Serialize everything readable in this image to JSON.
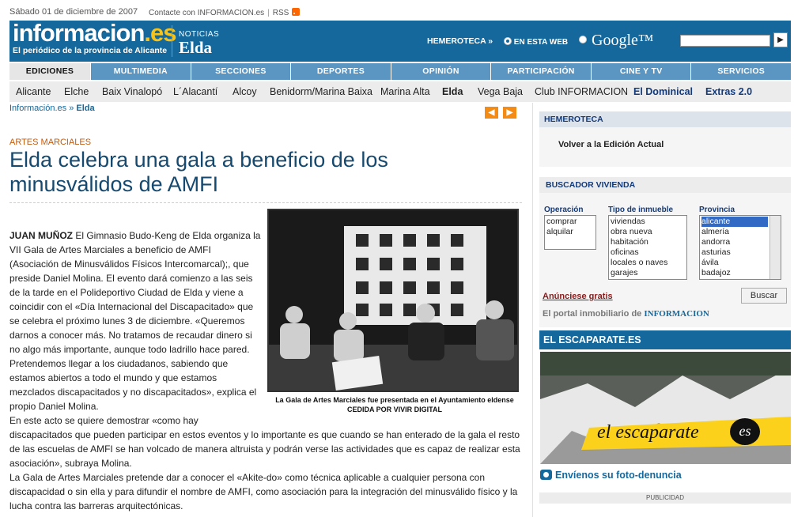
{
  "topbar": {
    "date": "Sábado 01 de diciembre de 2007",
    "contact": "Contacte con INFORMACION.es",
    "rss": "RSS"
  },
  "header": {
    "logo_main": "informacion",
    "logo_es": ".es",
    "logo_tagline": "El periódico de la provincia de Alicante",
    "section_kicker": "NOTICIAS",
    "section_name": "Elda",
    "hemeroteca": "HEMEROTECA »",
    "search_opt_web": "EN ESTA WEB",
    "search_opt_google": "Google™",
    "search_go": "▶"
  },
  "nav": {
    "items": [
      "EDICIONES",
      "MULTIMEDIA",
      "SECCIONES",
      "DEPORTES",
      "OPINIÓN",
      "PARTICIPACIÓN",
      "CINE Y TV",
      "SERVICIOS"
    ]
  },
  "subnav": {
    "items": [
      "Alicante",
      "Elche",
      "Baix Vinalopó",
      "L´Alacantí",
      "Alcoy",
      "Benidorm/Marina Baixa",
      "Marina Alta",
      "Elda",
      "Vega Baja",
      "Club INFORMACION",
      "El Dominical",
      "Extras 2.0"
    ]
  },
  "breadcrumb": {
    "home": "Información.es",
    "sep": " » ",
    "current": "Elda"
  },
  "article": {
    "kicker": "ARTES MARCIALES",
    "title": "Elda celebra una gala a beneficio de los minusválidos de AMFI",
    "author": "JUAN MUÑOZ",
    "p1": " El Gimnasio Budo-Keng de Elda organiza la VII Gala de Artes Marciales a beneficio de AMFI (Asociación de Minusválidos Físicos Intercomarcal);, que preside Daniel Molina. El evento dará comienzo a las seis de la tarde en el Polideportivo Ciudad de Elda y viene a coincidir con el «Día Internacional del Discapacitado» que se celebra el próximo lunes 3 de diciembre. «Queremos darnos a conocer más. No tratamos de recaudar dinero si no algo más importante, aunque todo ladrillo hace pared. Pretendemos llegar a los ciudadanos, sabiendo que estamos abiertos a todo el mundo y que estamos mezclados discapacitados y no discapacitados», explica el propio Daniel Molina.",
    "p2": "En este acto se quiere demostrar «como hay discapacitados que pueden participar en estos eventos y lo importante es que cuando se han enterado de la gala el resto de las escuelas de AMFI se han volcado de manera altruista y podrán verse las actividades que es capaz de realizar esta asociación», subraya Molina.",
    "p3": "La Gala de Artes Marciales pretende dar a conocer el «Akite-do» como técnica aplicable a cualquier persona con discapacidad o sin ella y para difundir el nombre de AMFI, como asociación para la integración del minusválido físico y la lucha contra las barreras arquitectónicas.",
    "caption": "La Gala de Artes Marciales fue presentada en el Ayuntamiento eldense   CEDIDA POR VIVIR DIGITAL"
  },
  "sidebar": {
    "hemeroteca_title": "HEMEROTECA",
    "hemeroteca_link": "Volver a la Edición Actual",
    "vivienda_title": "BUSCADOR VIVIENDA",
    "operacion_label": "Operación",
    "operacion_options": [
      "comprar",
      "alquilar"
    ],
    "tipo_label": "Tipo de inmueble",
    "tipo_options": [
      "viviendas",
      "obra nueva",
      "habitación",
      "oficinas",
      "locales o naves",
      "garajes"
    ],
    "provincia_label": "Provincia",
    "provincia_options": [
      "alicante",
      "almería",
      "andorra",
      "asturias",
      "ávila",
      "badajoz"
    ],
    "anunciese": "Anúnciese gratis",
    "buscar": "Buscar",
    "portal_text": "El portal inmobiliario de ",
    "portal_brand": "INFORMACION",
    "escaparate_title": "EL ESCAPARATE.ES",
    "escaparate_banner": "el escaparate",
    "escaparate_banner_es": "es",
    "foto_denuncia": "Envíenos su foto-denuncia",
    "publicidad": "PUBLICIDAD"
  },
  "colors": {
    "brand_blue": "#15689c",
    "nav_blue": "#5b96c2",
    "accent_orange": "#f38b14",
    "title_blue": "#15496f"
  }
}
